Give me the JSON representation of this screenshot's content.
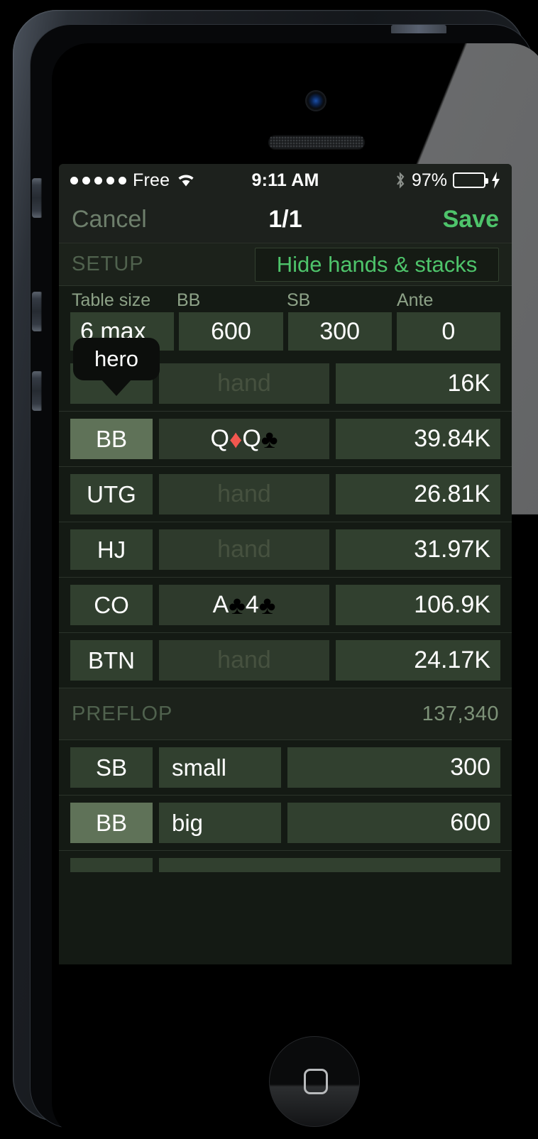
{
  "status_bar": {
    "signal_dots": 5,
    "carrier": "Free",
    "wifi_icon": "wifi-icon",
    "time": "9:11 AM",
    "bluetooth_icon": "bluetooth-icon",
    "battery_percent": "97%",
    "charging_icon": "lightning-bolt-icon",
    "battery_color": "#4cd964"
  },
  "nav_bar": {
    "cancel_label": "Cancel",
    "title": "1/1",
    "save_label": "Save",
    "save_color": "#4ec46b"
  },
  "setup": {
    "section_title": "SETUP",
    "hide_button_label": "Hide hands & stacks",
    "fields": [
      {
        "label": "Table size",
        "value": "6 max"
      },
      {
        "label": "BB",
        "value": "600"
      },
      {
        "label": "SB",
        "value": "300"
      },
      {
        "label": "Ante",
        "value": "0"
      }
    ]
  },
  "hero_tooltip": {
    "label": "hero"
  },
  "players": [
    {
      "position": "",
      "hand": "hand",
      "hand_is_placeholder": true,
      "stack": "16K",
      "highlighted": false,
      "cards": []
    },
    {
      "position": "BB",
      "hand": "",
      "hand_is_placeholder": false,
      "stack": "39.84K",
      "highlighted": true,
      "cards": [
        {
          "rank": "Q",
          "suit": "diamond",
          "glyph": "♦",
          "color": "#f2574f"
        },
        {
          "rank": "Q",
          "suit": "club",
          "glyph": "♣",
          "color": "#000000"
        }
      ]
    },
    {
      "position": "UTG",
      "hand": "hand",
      "hand_is_placeholder": true,
      "stack": "26.81K",
      "highlighted": false,
      "cards": []
    },
    {
      "position": "HJ",
      "hand": "hand",
      "hand_is_placeholder": true,
      "stack": "31.97K",
      "highlighted": false,
      "cards": []
    },
    {
      "position": "CO",
      "hand": "",
      "hand_is_placeholder": false,
      "stack": "106.9K",
      "highlighted": false,
      "cards": [
        {
          "rank": "A",
          "suit": "club",
          "glyph": "♣",
          "color": "#000000"
        },
        {
          "rank": "4",
          "suit": "club",
          "glyph": "♣",
          "color": "#000000"
        }
      ]
    },
    {
      "position": "BTN",
      "hand": "hand",
      "hand_is_placeholder": true,
      "stack": "24.17K",
      "highlighted": false,
      "cards": []
    }
  ],
  "preflop": {
    "section_title": "PREFLOP",
    "pot_total": "137,340",
    "actions": [
      {
        "position": "SB",
        "action": "small",
        "amount": "300",
        "highlighted": false
      },
      {
        "position": "BB",
        "action": "big",
        "amount": "600",
        "highlighted": true
      }
    ]
  },
  "theme": {
    "screen_bg": "#141a14",
    "field_bg": "#31402f",
    "hand_field_bg": "#2e3a2c",
    "highlight_bg": "#5f7258",
    "accent_green": "#4ec46b"
  }
}
